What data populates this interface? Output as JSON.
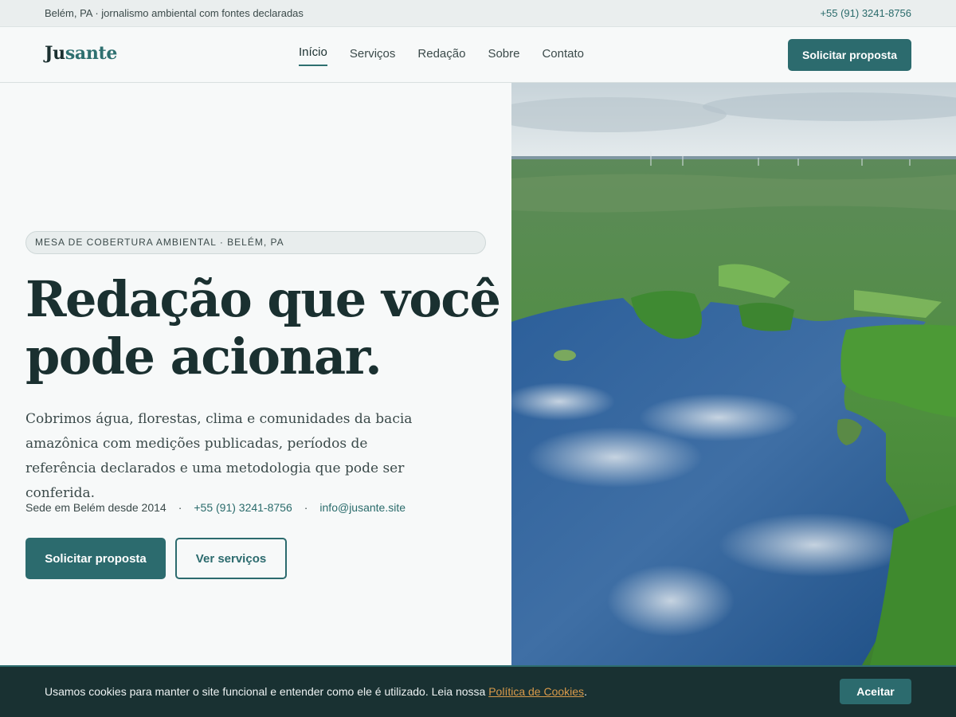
{
  "topbar": {
    "location_text": "Belém, PA · jornalismo ambiental com fontes declaradas",
    "phone": "+55 (91) 3241-8756"
  },
  "header": {
    "logo_part1": "Ju",
    "logo_part2": "sante",
    "nav": [
      {
        "label": "Início",
        "active": true
      },
      {
        "label": "Serviços",
        "active": false
      },
      {
        "label": "Redação",
        "active": false
      },
      {
        "label": "Sobre",
        "active": false
      },
      {
        "label": "Contato",
        "active": false
      }
    ],
    "cta_label": "Solicitar proposta"
  },
  "hero": {
    "badge": "MESA DE COBERTURA AMBIENTAL · BELÉM, PA",
    "headline_line1": "Redação que você",
    "headline_line2": "pode acionar.",
    "lead": "Cobrimos água, florestas, clima e comunidades da bacia amazônica com medições publicadas, períodos de referência declarados e uma metodologia que pode ser conferida.",
    "since": "Sede em Belém desde 2014",
    "phone": "+55 (91) 3241-8756",
    "email": "info@jusante.site",
    "separator": "·",
    "primary_button": "Solicitar proposta",
    "secondary_button": "Ver serviços",
    "image_icon": "aerial-lake-forest-photo"
  },
  "cookie_banner": {
    "message": "Usamos cookies para manter o site funcional e entender como ele é utilizado. Leia nossa ",
    "policy_link": "Política de Cookies",
    "period": ".",
    "accept_label": "Aceitar"
  },
  "colors": {
    "brand": "#2c6b6e",
    "dark": "#193132",
    "accent_link": "#d89a4a",
    "background": "#f7f9f9"
  }
}
